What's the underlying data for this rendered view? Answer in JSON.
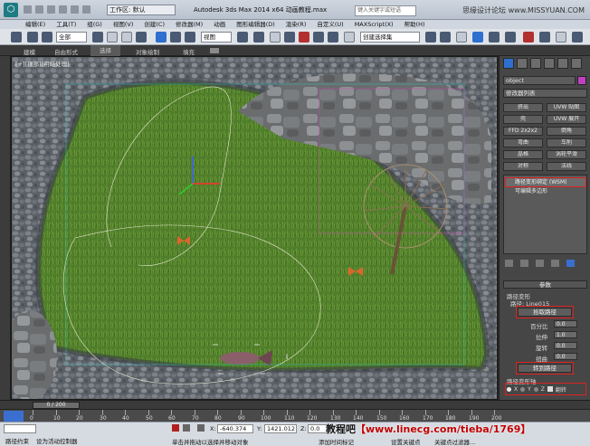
{
  "titlebar": {
    "workspace": "工作区: 默认",
    "title": "Autodesk 3ds Max  2014 x64      动画教程.max",
    "search_placeholder": "键入关键字或短语",
    "watermark": "思缘设计论坛 www.MISSYUAN.COM"
  },
  "menu": [
    "编辑(E)",
    "工具(T)",
    "组(G)",
    "视图(V)",
    "创建(C)",
    "修改器(M)",
    "动画",
    "图形编辑器(D)",
    "渲染(R)",
    "自定义(U)",
    "MAXScript(X)",
    "帮助(H)"
  ],
  "toolbar": {
    "filter_select": "全部",
    "coord_select": "视图",
    "named_selection": "创建选择集"
  },
  "ribbon": {
    "tabs": [
      "建模",
      "自由形式",
      "选择",
      "对象绘制",
      "填充"
    ],
    "active_index": 2
  },
  "viewport": {
    "label": "[+][顶部][明暗处理]"
  },
  "command_panel": {
    "object_name": "object",
    "modifier_list": "修改器列表",
    "buttons": [
      "挤出",
      "UVW 贴图",
      "壳",
      "UVW 展开",
      "FFD 2x2x2",
      "倒角",
      "弯曲",
      "车削",
      "晶格",
      "涡轮平滑",
      "对称",
      "法线"
    ],
    "stack": [
      {
        "label": "路径变形绑定 (WSM)",
        "highlight": true
      },
      {
        "label": "可编辑多边形",
        "highlight": false
      }
    ],
    "rollout_params": "参数",
    "path_deform_group": "路径变形",
    "path_label": "路径: Line015",
    "pick_path": "拾取路径",
    "rows": [
      {
        "label": "百分比",
        "value": "0.0"
      },
      {
        "label": "拉伸",
        "value": "1.0"
      },
      {
        "label": "旋转",
        "value": "0.0"
      },
      {
        "label": "扭曲",
        "value": "0.0"
      }
    ],
    "move_to_path": "转到路径",
    "axis_group": "路径变形轴",
    "axes": [
      "X",
      "Y",
      "Z"
    ],
    "flip_label": "翻转"
  },
  "timeline": {
    "slider_label": "0 / 200",
    "ticks": [
      "0",
      "10",
      "20",
      "30",
      "40",
      "50",
      "60",
      "70",
      "80",
      "90",
      "100",
      "110",
      "120",
      "130",
      "140",
      "150",
      "160",
      "170",
      "180",
      "190",
      "200"
    ]
  },
  "status": {
    "selection_info": "路径约束",
    "prompt": "单击并拖动以选择并移动对象",
    "mode_hint": "设为活动控制器",
    "x_label": "X:",
    "x_value": "-640.374",
    "y_label": "Y:",
    "y_value": "1421.012",
    "z_label": "Z:",
    "z_value": "0.0",
    "add_time_tag": "添加时间标记",
    "set_key": "设置关键点",
    "key_filter": "关键点过滤器..."
  },
  "credit": {
    "site": "教程吧",
    "url": "【www.linecg.com/tieba/1769】"
  },
  "colors": {
    "highlight_red": "#e02020",
    "grass": "#4f7d2a",
    "stone": "#6b6f72",
    "fish": "#8a5f6a",
    "butterfly": "#d9672a"
  }
}
